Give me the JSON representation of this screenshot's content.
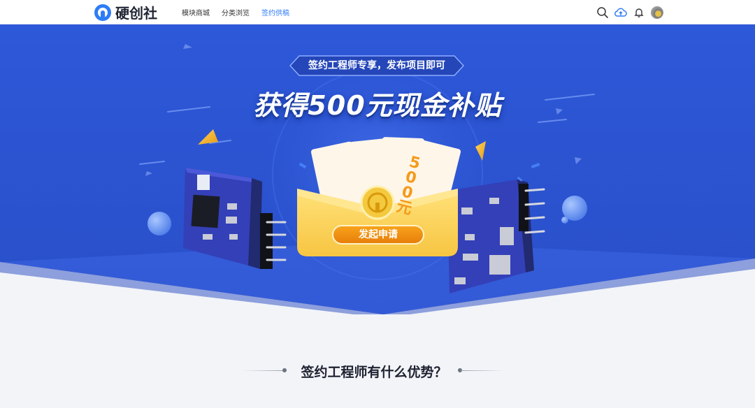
{
  "header": {
    "logo_text": "硬创社",
    "nav": [
      {
        "label": "模块商城",
        "active": false
      },
      {
        "label": "分类浏览",
        "active": false
      },
      {
        "label": "签约供稿",
        "active": true
      }
    ],
    "icons": [
      "search-icon",
      "cloud-upload-icon",
      "bell-icon",
      "avatar"
    ]
  },
  "hero": {
    "badge": "签约工程师专享，发布项目即可",
    "headline": "获得500元现金补贴",
    "bill_label": "500元",
    "apply_button": "发起申请"
  },
  "section": {
    "title": "签约工程师有什么优势？"
  },
  "colors": {
    "accent": "#2f7cf6",
    "hero_blue": "#2f5bdc",
    "button_orange": "#f08f12",
    "page_bg": "#f2f4f8"
  }
}
